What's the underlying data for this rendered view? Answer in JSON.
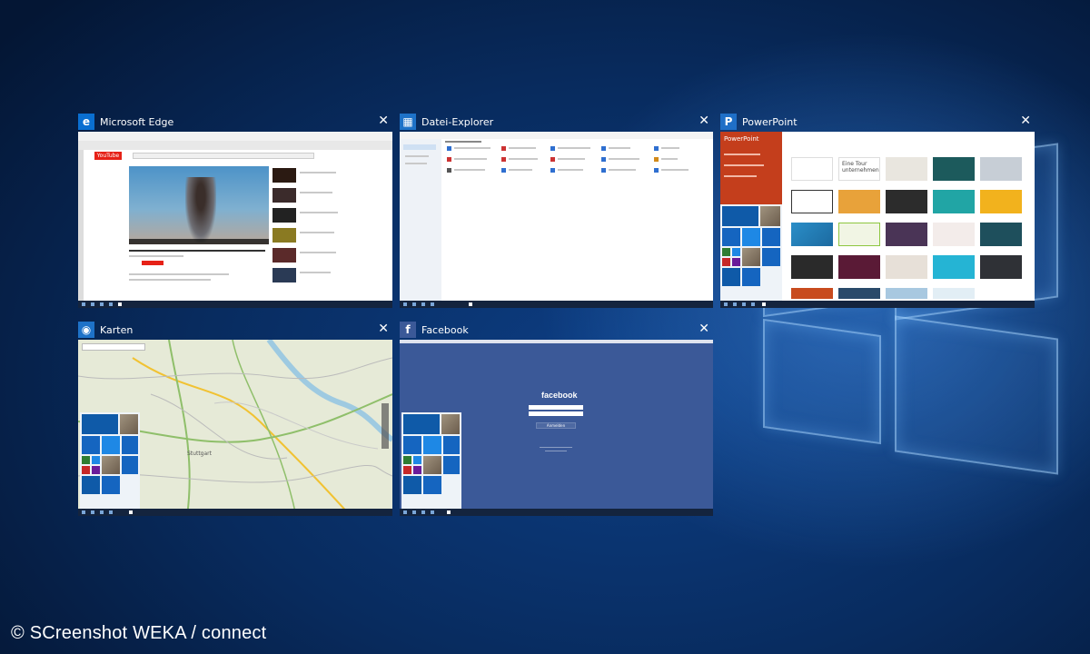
{
  "task_view": {
    "windows": [
      {
        "id": "edge",
        "title": "Microsoft Edge",
        "icon": "edge-icon",
        "icon_glyph": "e",
        "icon_color": "#0a6fd1",
        "close": "✕"
      },
      {
        "id": "explorer",
        "title": "Datei-Explorer",
        "icon": "folder-icon",
        "icon_glyph": "▦",
        "icon_color": "#1e72c8",
        "close": "✕"
      },
      {
        "id": "powerpoint",
        "title": "PowerPoint",
        "icon": "powerpoint-icon",
        "icon_glyph": "P",
        "icon_color": "#1f6fc7",
        "close": "✕"
      },
      {
        "id": "maps",
        "title": "Karten",
        "icon": "maps-icon",
        "icon_glyph": "◉",
        "icon_color": "#1e72c8",
        "close": "✕"
      },
      {
        "id": "facebook",
        "title": "Facebook",
        "icon": "facebook-icon",
        "icon_glyph": "f",
        "icon_color": "#3b5998",
        "close": "✕"
      }
    ]
  },
  "edge_content": {
    "yt_logo": "YouTube"
  },
  "powerpoint_content": {
    "sidebar_title": "PowerPoint",
    "tile1": "Eine Tour unternehmen"
  },
  "maps_content": {
    "city_label": "Stuttgart"
  },
  "facebook_content": {
    "brand": "facebook",
    "login_button": "Anmelden"
  },
  "credit": "© SCreenshot WEKA / connect",
  "colors": {
    "desktop": "#082b5e",
    "accent": "#1565c0",
    "powerpoint": "#c43e1c",
    "facebook": "#3b5998"
  }
}
